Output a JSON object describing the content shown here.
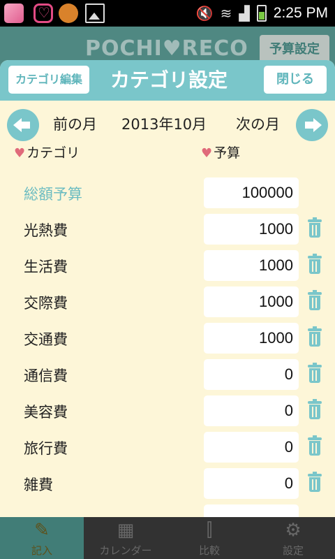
{
  "status_bar": {
    "time": "2:25 PM"
  },
  "background": {
    "logo": "POCHI♥RECO",
    "budget_button": "予算設定",
    "nav": [
      {
        "label": "記入",
        "icon": "pencil-icon"
      },
      {
        "label": "カレンダー",
        "icon": "calendar-icon"
      },
      {
        "label": "比較",
        "icon": "sliders-icon"
      },
      {
        "label": "設定",
        "icon": "gear-icon"
      }
    ]
  },
  "dialog": {
    "title": "カテゴリ設定",
    "edit_button": "カテゴリ編集",
    "close_button": "閉じる",
    "month_nav": {
      "prev": "前の月",
      "current": "2013年10月",
      "next": "次の月"
    },
    "columns": {
      "category": "カテゴリ",
      "budget": "予算"
    },
    "total": {
      "label": "総額予算",
      "value": "100000"
    },
    "rows": [
      {
        "label": "光熱費",
        "value": "1000"
      },
      {
        "label": "生活費",
        "value": "1000"
      },
      {
        "label": "交際費",
        "value": "1000"
      },
      {
        "label": "交通費",
        "value": "1000"
      },
      {
        "label": "通信費",
        "value": "0"
      },
      {
        "label": "美容費",
        "value": "0"
      },
      {
        "label": "旅行費",
        "value": "0"
      },
      {
        "label": "雑費",
        "value": "0"
      }
    ]
  },
  "colors": {
    "accent": "#7ac6ca",
    "panel": "#fdf6d8",
    "heart": "#e06a7a"
  }
}
